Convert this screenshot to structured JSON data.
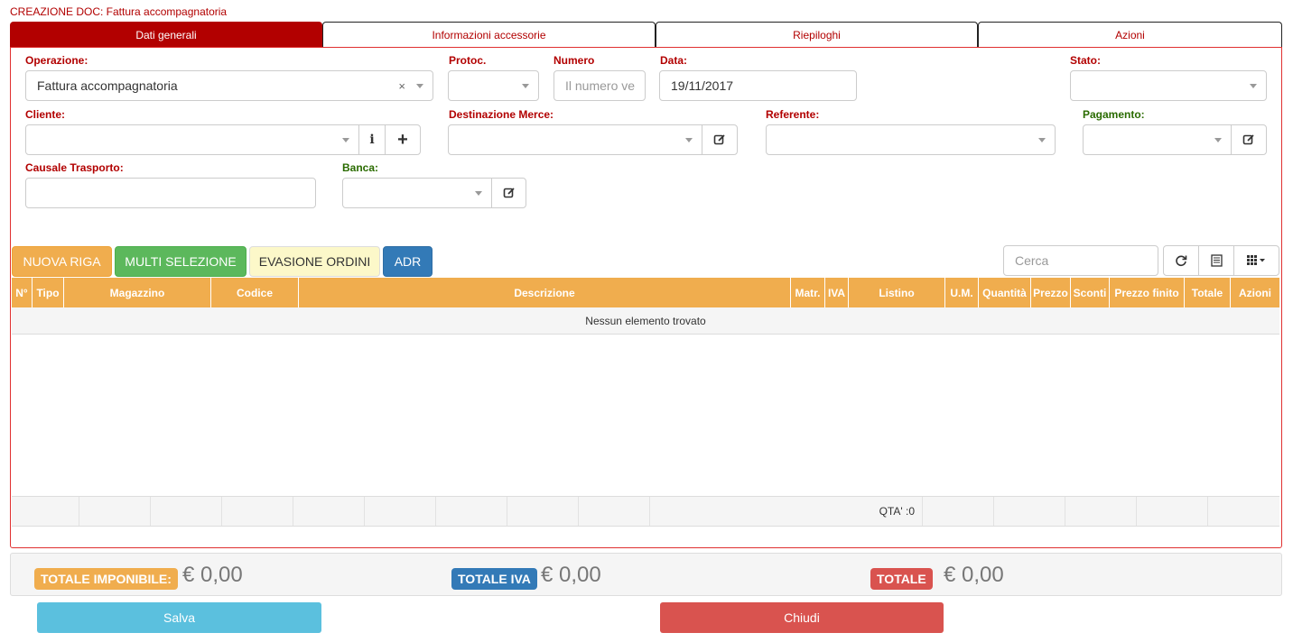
{
  "page_title": "CREAZIONE DOC: Fattura accompagnatoria",
  "tabs": [
    {
      "label": "Dati generali"
    },
    {
      "label": "Informazioni accessorie"
    },
    {
      "label": "Riepiloghi"
    },
    {
      "label": "Azioni"
    }
  ],
  "form": {
    "operazione": {
      "label": "Operazione:",
      "value": "Fattura accompagnatoria"
    },
    "protoc": {
      "label": "Protoc.",
      "value": ""
    },
    "numero": {
      "label": "Numero",
      "placeholder": "Il numero ve"
    },
    "data": {
      "label": "Data:",
      "value": "19/11/2017"
    },
    "stato": {
      "label": "Stato:",
      "value": ""
    },
    "cliente": {
      "label": "Cliente:",
      "value": "",
      "info_icon": "i",
      "add_icon": "+"
    },
    "destinazione": {
      "label": "Destinazione Merce:",
      "value": ""
    },
    "referente": {
      "label": "Referente:",
      "value": ""
    },
    "pagamento": {
      "label": "Pagamento:",
      "value": ""
    },
    "causale": {
      "label": "Causale Trasporto:",
      "value": ""
    },
    "banca": {
      "label": "Banca:",
      "value": ""
    }
  },
  "toolbar": {
    "nuova_riga": "NUOVA RIGA",
    "multi_selezione": "MULTI SELEZIONE",
    "evasione_ordini": "EVASIONE ORDINI",
    "adr": "ADR",
    "search_placeholder": "Cerca"
  },
  "table": {
    "columns": [
      "N°",
      "Tipo",
      "Magazzino",
      "Codice",
      "Descrizione",
      "Matr.",
      "IVA",
      "Listino",
      "U.M.",
      "Quantità",
      "Prezzo",
      "Sconti",
      "Prezzo finito",
      "Totale",
      "Azioni"
    ],
    "empty_message": "Nessun elemento trovato",
    "footer_qta": "QTA' :0"
  },
  "totals": {
    "imponibile_label": "TOTALE IMPONIBILE:",
    "imponibile_value": "€ 0,00",
    "iva_label": "TOTALE IVA",
    "iva_value": "€ 0,00",
    "totale_label": "TOTALE",
    "totale_value": "€ 0,00"
  },
  "actions": {
    "salva": "Salva",
    "chiudi": "Chiudi"
  },
  "colors": {
    "brand_red": "#b20000",
    "orange": "#f0ad4e",
    "green": "#5cb85c",
    "blue": "#337ab7",
    "info": "#5bc0de",
    "danger": "#d9534f"
  }
}
